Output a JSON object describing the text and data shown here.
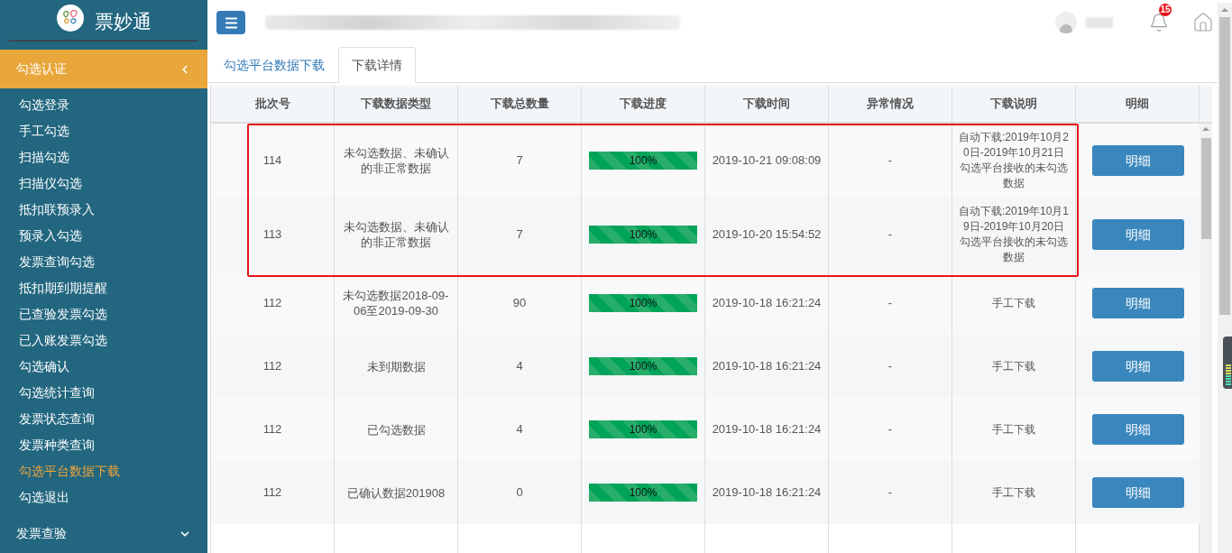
{
  "sidebar": {
    "logo_text": "票妙通",
    "groups": [
      {
        "label": "勾选认证",
        "expanded": true,
        "items": [
          {
            "label": "勾选登录",
            "selected": false
          },
          {
            "label": "手工勾选",
            "selected": false
          },
          {
            "label": "扫描勾选",
            "selected": false
          },
          {
            "label": "扫描仪勾选",
            "selected": false
          },
          {
            "label": "抵扣联预录入",
            "selected": false
          },
          {
            "label": "预录入勾选",
            "selected": false
          },
          {
            "label": "发票查询勾选",
            "selected": false
          },
          {
            "label": "抵扣期到期提醒",
            "selected": false
          },
          {
            "label": "已查验发票勾选",
            "selected": false
          },
          {
            "label": "已入账发票勾选",
            "selected": false
          },
          {
            "label": "勾选确认",
            "selected": false
          },
          {
            "label": "勾选统计查询",
            "selected": false
          },
          {
            "label": "发票状态查询",
            "selected": false
          },
          {
            "label": "发票种类查询",
            "selected": false
          },
          {
            "label": "勾选平台数据下载",
            "selected": true
          },
          {
            "label": "勾选退出",
            "selected": false
          }
        ]
      },
      {
        "label": "发票查验",
        "expanded": false
      }
    ]
  },
  "header": {
    "notification_count": "15"
  },
  "tabs": [
    {
      "label": "勾选平台数据下载",
      "selected": false
    },
    {
      "label": "下载详情",
      "selected": true
    }
  ],
  "table": {
    "columns": [
      "批次号",
      "下载数据类型",
      "下载总数量",
      "下载进度",
      "下载时间",
      "异常情况",
      "下载说明",
      "明细"
    ],
    "rows": [
      {
        "batch": "114",
        "type": "未勾选数据、未确认的非正常数据",
        "count": "7",
        "level": 1,
        "progress_text": "100%",
        "time": "2019-10-21 09:08:09",
        "anomaly": "-",
        "note": "自动下载:2019年10月20日-2019年10月21日勾选平台接收的未勾选数据",
        "button": "明细",
        "highlighted": true
      },
      {
        "batch": "113",
        "type": "未勾选数据、未确认的非正常数据",
        "count": "7",
        "level": 1,
        "progress_text": "100%",
        "time": "2019-10-20 15:54:52",
        "anomaly": "-",
        "note": "自动下载:2019年10月19日-2019年10月20日勾选平台接收的未勾选数据",
        "button": "明细",
        "highlighted": true
      },
      {
        "batch": "112",
        "type": "未勾选数据2018-09-06至2019-09-30",
        "count": "90",
        "level": 1,
        "progress_text": "100%",
        "time": "2019-10-18 16:21:24",
        "anomaly": "-",
        "note": "手工下载",
        "button": "明细",
        "highlighted": false
      },
      {
        "batch": "112",
        "type": "未到期数据",
        "count": "4",
        "level": 1,
        "progress_text": "100%",
        "time": "2019-10-18 16:21:24",
        "anomaly": "-",
        "note": "手工下载",
        "button": "明细",
        "highlighted": false
      },
      {
        "batch": "112",
        "type": "已勾选数据",
        "count": "4",
        "level": 1,
        "progress_text": "100%",
        "time": "2019-10-18 16:21:24",
        "anomaly": "-",
        "note": "手工下载",
        "button": "明细",
        "highlighted": false
      },
      {
        "batch": "112",
        "type": "已确认数据201908",
        "count": "0",
        "level": 1,
        "progress_text": "100%",
        "time": "2019-10-18 16:21:24",
        "anomaly": "-",
        "note": "手工下载",
        "button": "明细",
        "highlighted": false
      }
    ]
  }
}
